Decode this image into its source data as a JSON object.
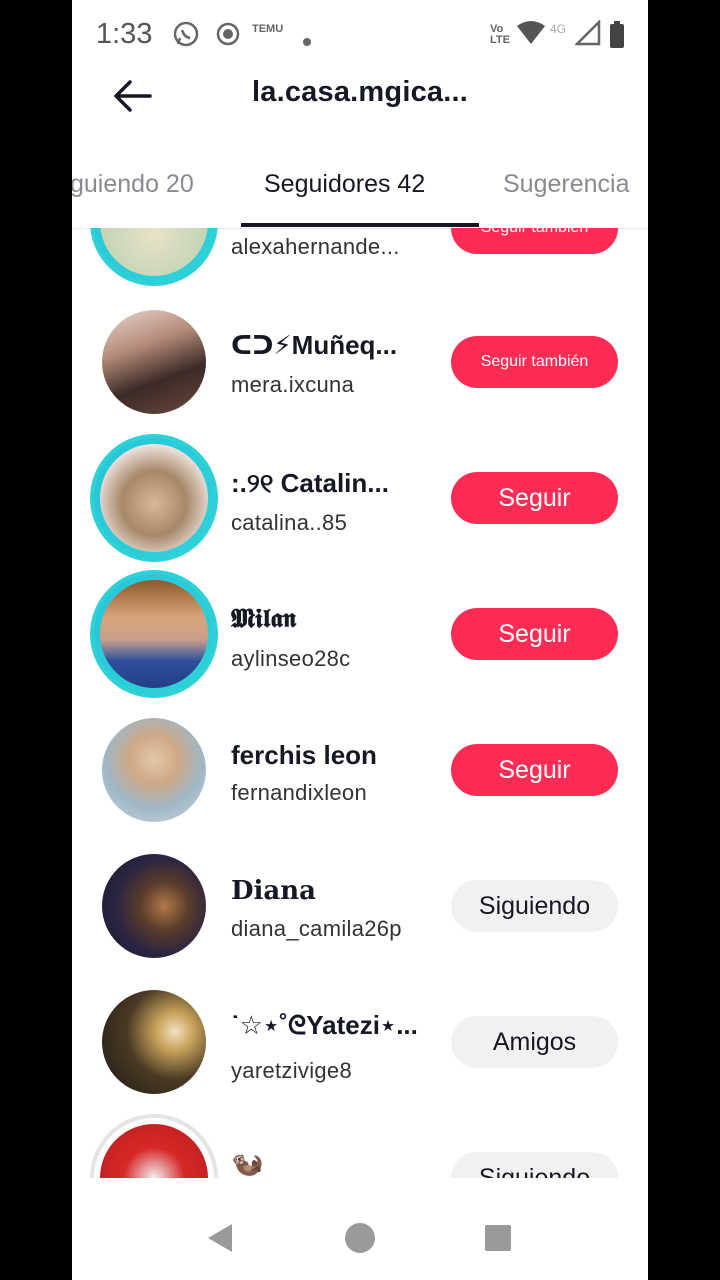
{
  "status_bar": {
    "time": "1:33",
    "network_label": "4G",
    "volte_label": "Vo LTE",
    "temu_label": "TEMU"
  },
  "header": {
    "title": "la.casa.mgica..."
  },
  "tabs": [
    {
      "label": "guiendo 20",
      "active": false
    },
    {
      "label": "Seguidores 42",
      "active": true
    },
    {
      "label": "Sugerencia",
      "active": false
    }
  ],
  "followers": [
    {
      "name": "",
      "username": "alexahernande...",
      "button": "Seguir también",
      "button_style": "red"
    },
    {
      "name": "ᑕᑐ⚡Muñeq...",
      "username": "mera.ixcuna",
      "button": "Seguir también",
      "button_style": "red"
    },
    {
      "name": ":.୨୧ Catalin...",
      "username": "catalina..85",
      "button": "Seguir",
      "button_style": "red"
    },
    {
      "name": "𝕸𝖎𝖑𝖆𝖓",
      "username": "aylinseo28c",
      "button": "Seguir",
      "button_style": "red"
    },
    {
      "name": "ferchis leon",
      "username": "fernandixleon",
      "button": "Seguir",
      "button_style": "red"
    },
    {
      "name": "Diana",
      "username": "diana_camila26p",
      "button": "Siguiendo",
      "button_style": "gray"
    },
    {
      "name": "˙☆⋆˚ᘓYatezi⋆...",
      "username": "yaretzivige8",
      "button": "Amigos",
      "button_style": "gray"
    },
    {
      "name": "🦦",
      "username": "",
      "button": "Siguiendo",
      "button_style": "gray"
    }
  ],
  "colors": {
    "accent_red": "#fe2c55",
    "ring_cyan": "#2fd1d7",
    "text_dark": "#161823"
  },
  "icons": [
    "back-arrow-icon",
    "whatsapp-icon",
    "record-icon",
    "signal-icon",
    "wifi-icon",
    "battery-icon",
    "nav-back-icon",
    "nav-home-icon",
    "nav-recents-icon"
  ]
}
